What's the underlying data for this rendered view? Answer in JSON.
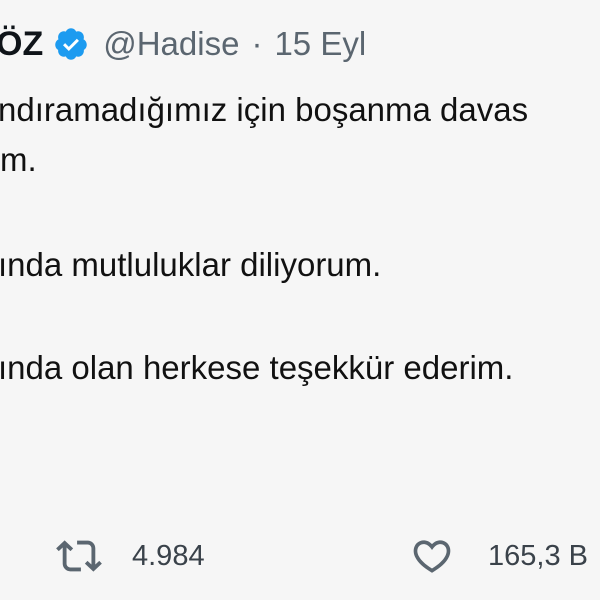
{
  "tweet": {
    "author_name": "ÖZ",
    "handle": "@Hadise",
    "separator": "·",
    "date": "15 Eyl",
    "body_lines": [
      "ndıramadığımız için boşanma davas",
      "m.",
      "ında mutluluklar diliyorum.",
      "ında olan herkese teşekkür ederim."
    ]
  },
  "actions": {
    "retweet_count": "4.984",
    "like_count": "165,3 B"
  },
  "colors": {
    "verified": "#1d9bf0",
    "text": "#0f1419",
    "muted": "#5b6670",
    "background": "#f6f6f6"
  },
  "icons": {
    "verified": "verified-badge-icon",
    "retweet": "retweet-icon",
    "like": "heart-icon"
  }
}
